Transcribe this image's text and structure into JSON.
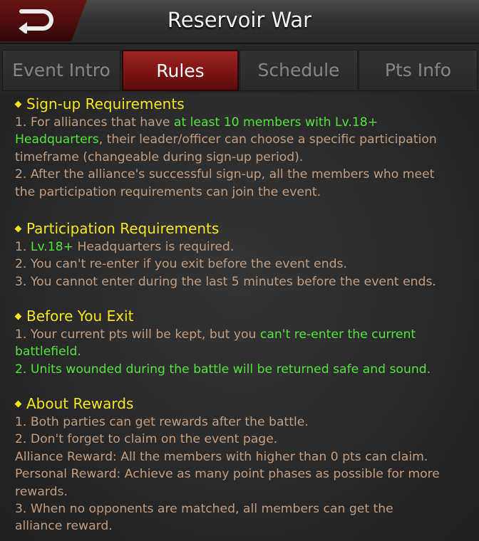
{
  "header": {
    "title": "Reservoir War",
    "back_icon": "back-arrow-icon"
  },
  "tabs": [
    {
      "label": "Event Intro",
      "active": false
    },
    {
      "label": "Rules",
      "active": true
    },
    {
      "label": "Schedule",
      "active": false
    },
    {
      "label": "Pts Info",
      "active": false
    }
  ],
  "colors": {
    "heading": "#f5e51e",
    "body": "#bf9d82",
    "highlight": "#52e23c",
    "active_tab": "#8b1a1a"
  },
  "sections": [
    {
      "title": "Sign-up Requirements",
      "lines": [
        [
          {
            "t": "1. For alliances that have "
          },
          {
            "t": "at least 10 members with Lv.18+",
            "hl": true
          }
        ],
        [
          {
            "t": "Headquarters",
            "hl": true
          },
          {
            "t": ", their leader/officer can choose a specific participation"
          }
        ],
        [
          {
            "t": "timeframe (changeable during sign-up period)."
          }
        ],
        [
          {
            "t": "2. After the alliance's successful sign-up, all the members who meet"
          }
        ],
        [
          {
            "t": "the participation requirements can join the event."
          }
        ]
      ]
    },
    {
      "title": "Participation Requirements",
      "lines": [
        [
          {
            "t": "1. "
          },
          {
            "t": "Lv.18+",
            "hl": true
          },
          {
            "t": " Headquarters is required."
          }
        ],
        [
          {
            "t": "2. You can't re-enter if you exit before the event ends."
          }
        ],
        [
          {
            "t": "3. You cannot enter during the last 5 minutes before the event ends."
          }
        ]
      ]
    },
    {
      "title": "Before You Exit",
      "lines": [
        [
          {
            "t": "1. Your current pts will be kept, but you "
          },
          {
            "t": "can't re-enter the current",
            "hl": true
          }
        ],
        [
          {
            "t": "battlefield.",
            "hl": true
          }
        ],
        [
          {
            "t": "2. Units wounded during the battle will be returned safe and sound.",
            "hl": true
          }
        ]
      ]
    },
    {
      "title": "About Rewards",
      "lines": [
        [
          {
            "t": "1. Both parties can get rewards after the battle."
          }
        ],
        [
          {
            "t": "2. Don't forget to claim on the event page."
          }
        ],
        [
          {
            "t": "Alliance Reward: All the members with higher than 0 pts can claim."
          }
        ],
        [
          {
            "t": "Personal Reward: Achieve as many point phases as possible for more"
          }
        ],
        [
          {
            "t": "rewards."
          }
        ],
        [
          {
            "t": "3. When no opponents are matched, all members can get the"
          }
        ],
        [
          {
            "t": "alliance reward."
          }
        ]
      ]
    }
  ]
}
